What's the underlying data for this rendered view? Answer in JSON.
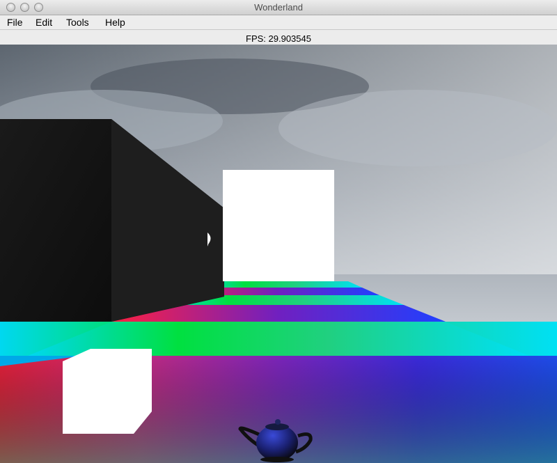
{
  "window": {
    "title": "Wonderland"
  },
  "menu": {
    "items": [
      {
        "label": "File"
      },
      {
        "label": "Edit"
      },
      {
        "label": "Tools"
      },
      {
        "label": "Help"
      }
    ]
  },
  "status": {
    "fps": "FPS: 29.903545"
  },
  "scene": {
    "objects": [
      "sky",
      "rainbow-floor",
      "dark-wall-block",
      "white-cube-far",
      "white-cube-near",
      "teapot"
    ]
  }
}
